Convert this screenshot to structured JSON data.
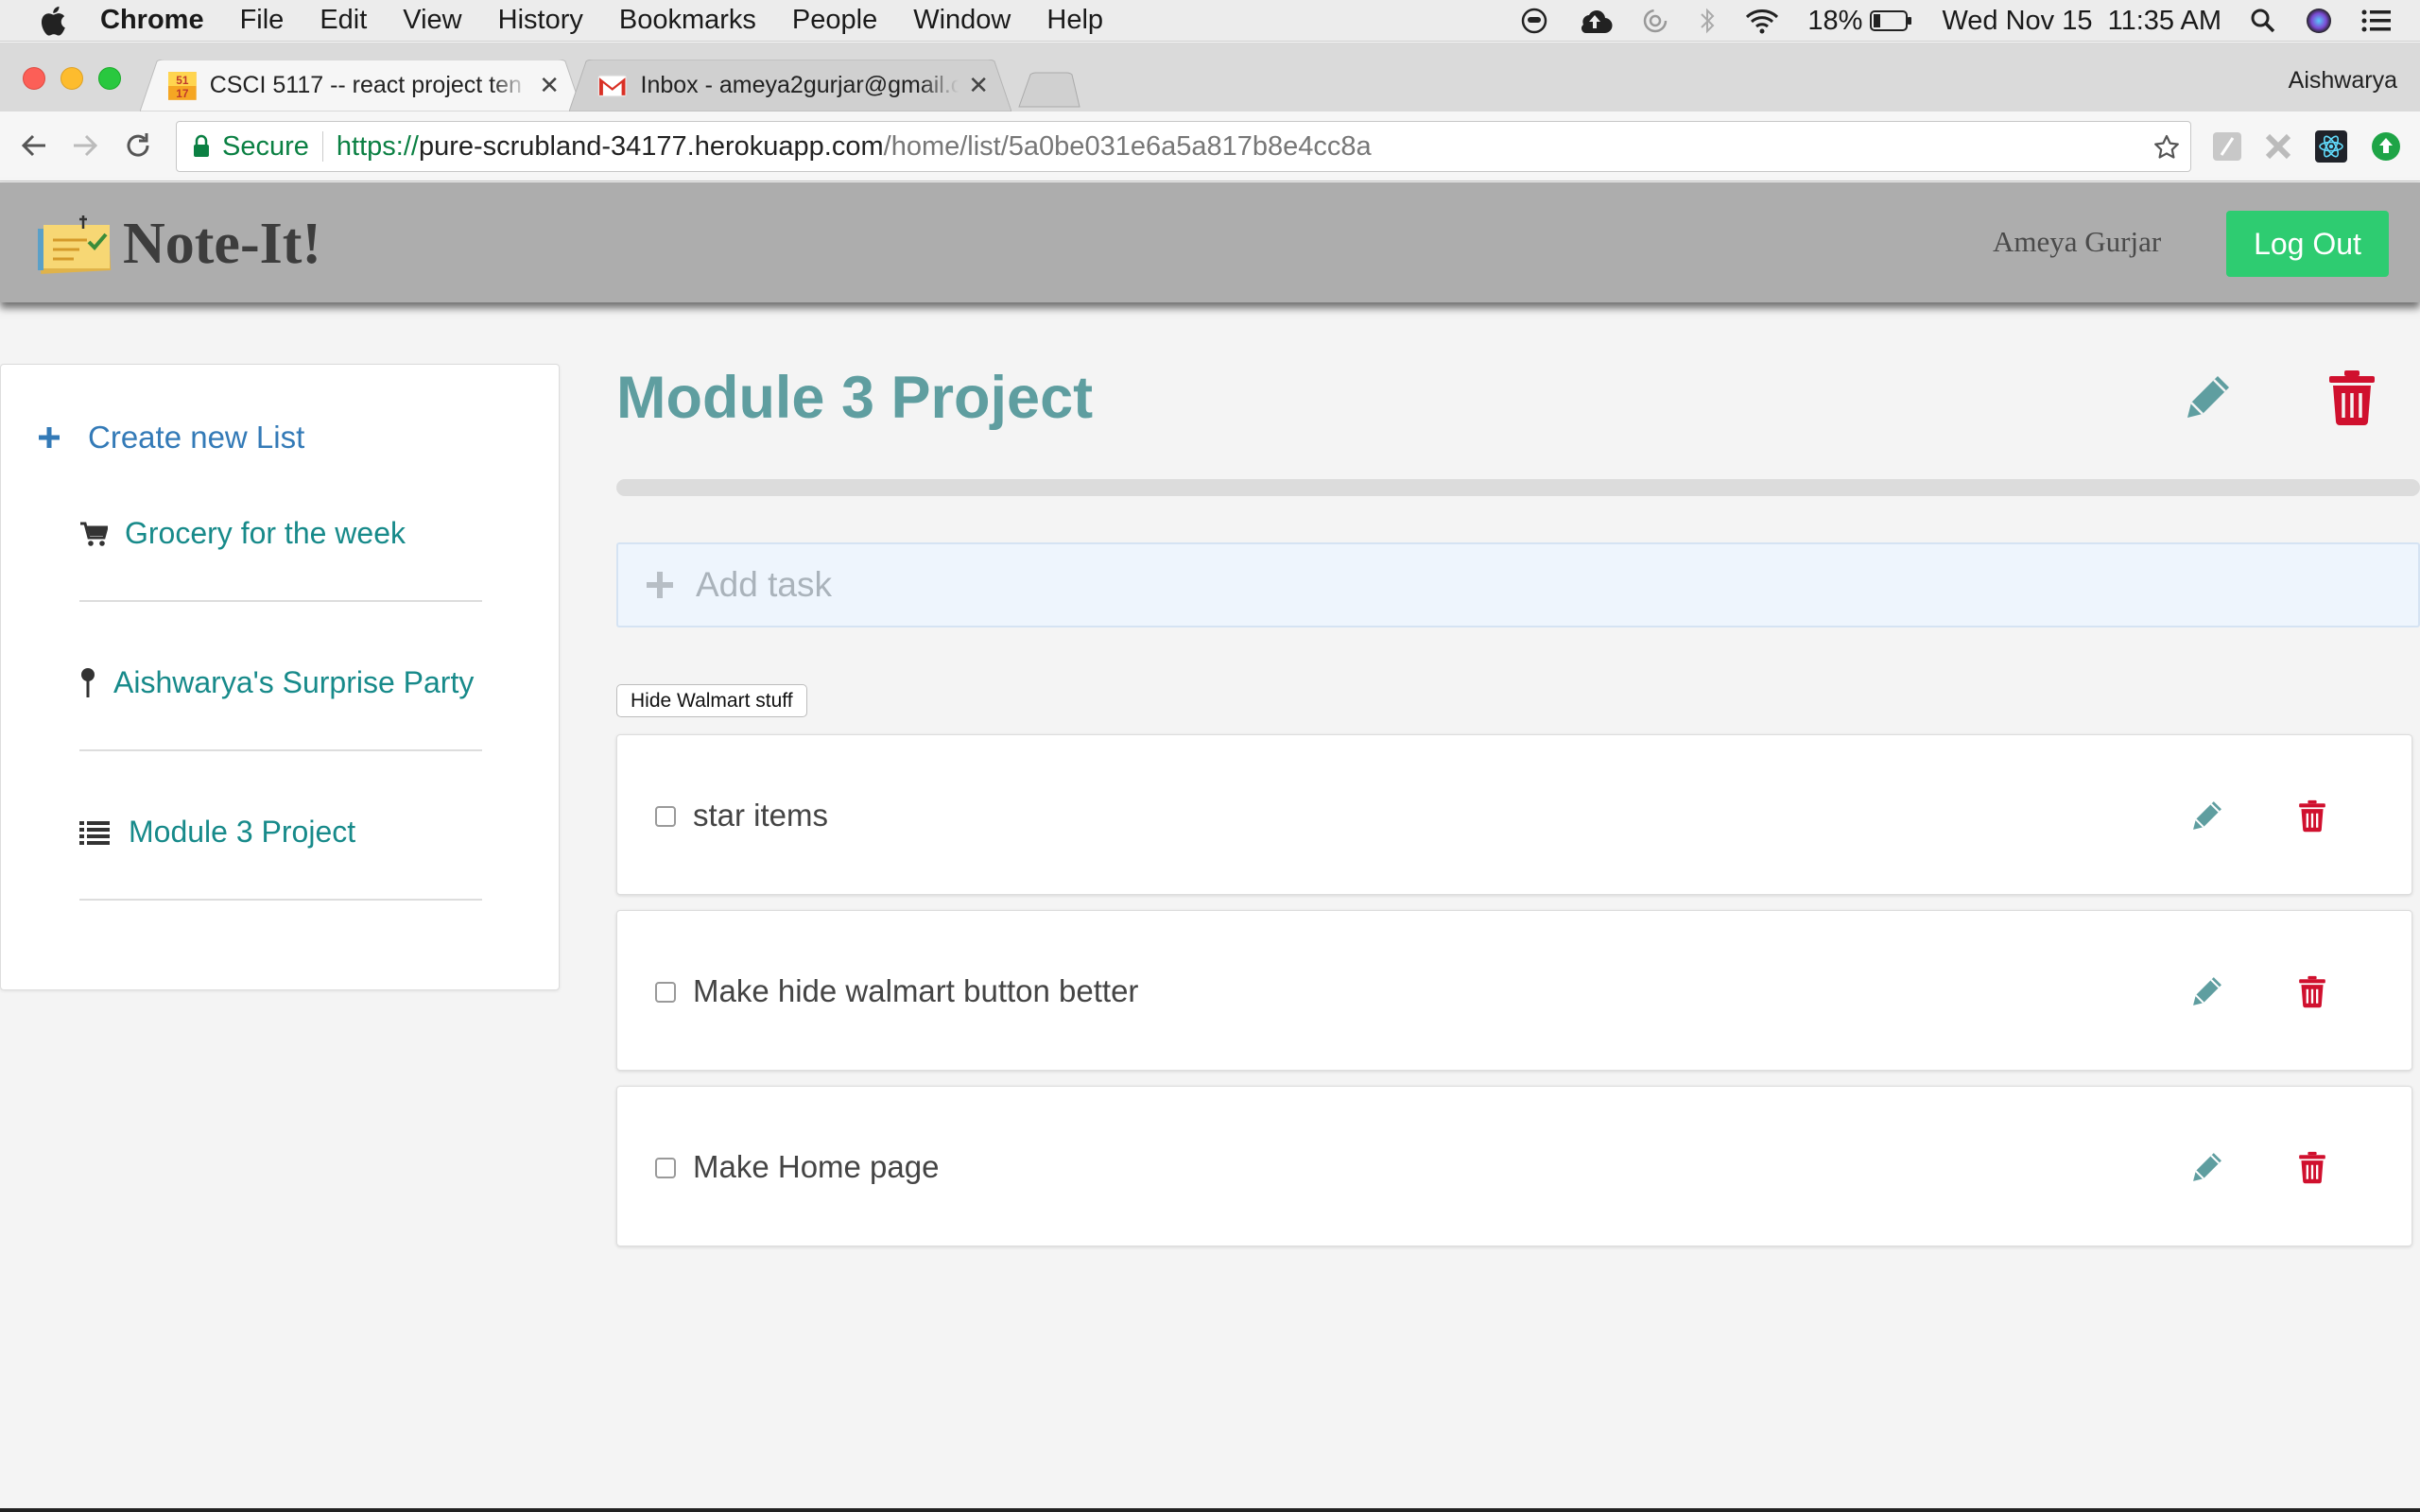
{
  "os_menubar": {
    "app_name": "Chrome",
    "menus": [
      "File",
      "Edit",
      "View",
      "History",
      "Bookmarks",
      "People",
      "Window",
      "Help"
    ],
    "battery_percent": "18%",
    "datetime": "Wed Nov 15  11:35 AM"
  },
  "browser": {
    "tabs": [
      {
        "title": "CSCI 5117 -- react project ten",
        "favicon": "csci-5117-favicon",
        "active": true
      },
      {
        "title": "Inbox - ameya2gurjar@gmail.co",
        "favicon": "gmail-icon",
        "active": false
      }
    ],
    "profile_name": "Aishwarya",
    "secure_label": "Secure",
    "url": {
      "scheme": "https://",
      "host": "pure-scrubland-34177.herokuapp.com",
      "path": "/home/list/5a0be031e6a5a817b8e4cc8a"
    }
  },
  "app": {
    "brand": "Note-It!",
    "user_name": "Ameya Gurjar",
    "logout_label": "Log Out"
  },
  "sidebar": {
    "create_label": "Create new List",
    "lists": [
      {
        "label": "Grocery for the week",
        "icon": "cart-icon"
      },
      {
        "label": "Aishwarya's Surprise Party",
        "icon": "pushpin-icon"
      },
      {
        "label": "Module 3 Project",
        "icon": "list-icon"
      }
    ]
  },
  "main": {
    "list_title": "Module 3 Project",
    "progress_fraction": 0,
    "add_task_placeholder": "Add task",
    "hide_button_label": "Hide Walmart stuff",
    "tasks": [
      {
        "text": "star items",
        "checked": false
      },
      {
        "text": "Make hide walmart button better",
        "checked": false
      },
      {
        "text": "Make Home page",
        "checked": false
      }
    ]
  },
  "colors": {
    "teal": "#5f9ea0",
    "delete_red": "#d0102e",
    "logout_green": "#2ecc71",
    "navbar_gray": "#adadad",
    "link_blue": "#337ab7"
  }
}
